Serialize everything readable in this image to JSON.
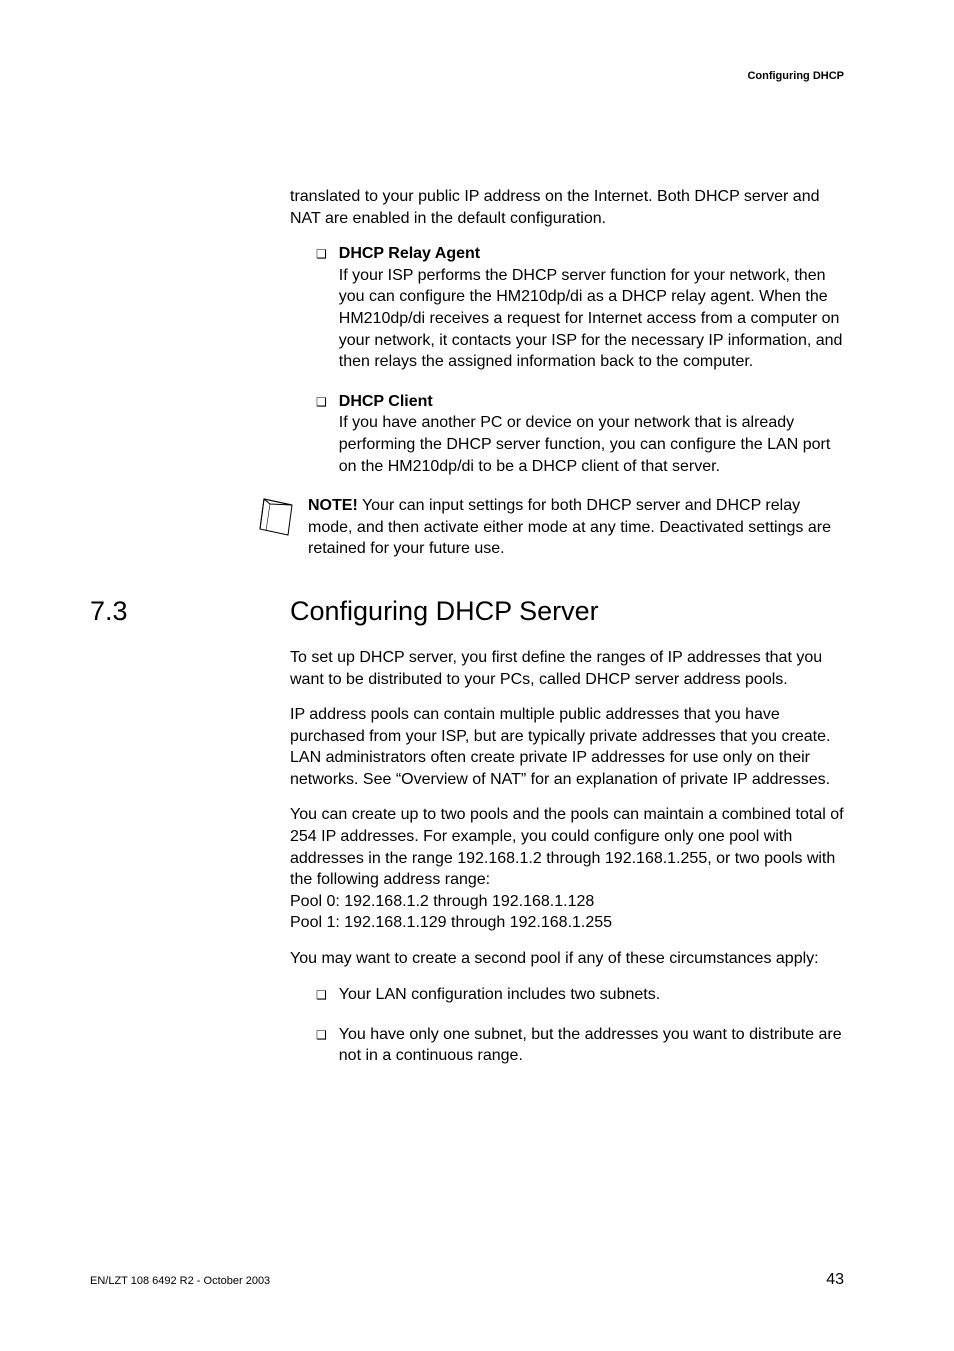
{
  "runningHead": "Configuring DHCP",
  "intro": "translated to your public IP address on the Internet. Both DHCP server and NAT are enabled in the default configuration.",
  "items": [
    {
      "heading": "DHCP Relay Agent",
      "body": "If your ISP performs the DHCP server function for your network, then you can configure the HM210dp/di as a DHCP relay agent. When the HM210dp/di receives a request for Internet access from a computer on your network, it contacts your ISP for the necessary IP information, and then relays the assigned information back to the computer."
    },
    {
      "heading": "DHCP Client",
      "body": "If you have another PC or device on your network that is already performing the DHCP server function, you can configure the LAN port on the HM210dp/di to be a DHCP client of that server."
    }
  ],
  "note": {
    "label": "NOTE!",
    "text": " Your can input settings for both DHCP server and DHCP relay mode, and then activate either mode at any time. Deactivated settings are retained for your future use."
  },
  "section": {
    "num": "7.3",
    "title": "Configuring DHCP Server"
  },
  "paras": [
    "To set up DHCP server, you first define the ranges of IP addresses that you want to be distributed to your PCs, called DHCP server address pools.",
    "IP address pools can contain multiple public addresses that you have purchased from your ISP, but are typically private addresses that you create. LAN administrators often create private IP addresses for use only on their networks. See “Overview of NAT” for an explanation of private IP addresses.",
    "You can create up to two pools and the pools can maintain a combined total of 254 IP addresses. For example, you could configure only one pool with addresses in the range 192.168.1.2 through 192.168.1.255, or two pools with the following address range:\nPool 0: 192.168.1.2 through 192.168.1.128\nPool 1: 192.168.1.129 through 192.168.1.255",
    "You may want to create a second pool if any of these circumstances apply:"
  ],
  "bullets": [
    "Your LAN configuration includes two subnets.",
    "You have only one subnet, but the addresses you want to distribute are not in a continuous range."
  ],
  "footer": {
    "left": "EN/LZT 108 6492 R2 - October 2003",
    "right": "43"
  }
}
